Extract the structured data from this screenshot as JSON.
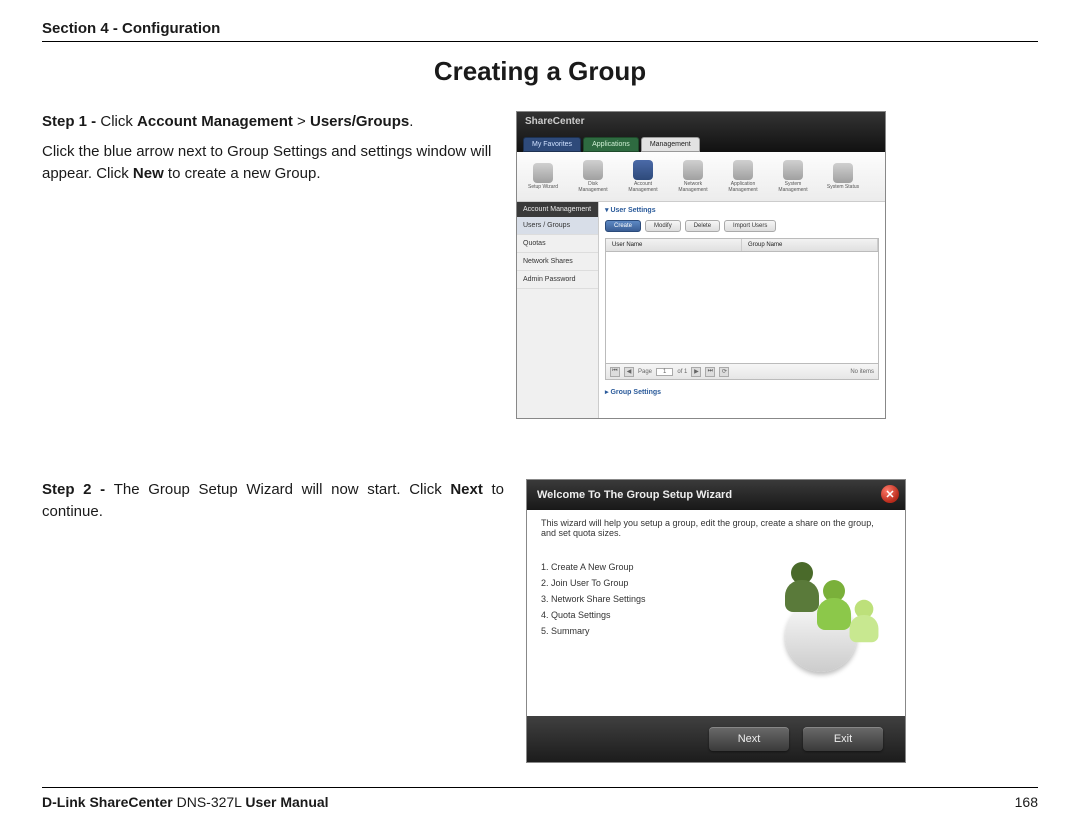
{
  "header": {
    "section": "Section 4 - Configuration"
  },
  "title": "Creating a Group",
  "step1": {
    "prefix": "Step 1 - ",
    "action": "Click ",
    "bold1": "Account Management",
    "gt": " > ",
    "bold2": "Users/Groups",
    "tail": ".",
    "body1": "Click the blue arrow next to Group Settings and settings window will appear. Click ",
    "bold_new": "New",
    "body2": " to create a new Group."
  },
  "shot1": {
    "logo": "ShareCenter",
    "tabs": [
      "My Favorites",
      "Applications",
      "Management"
    ],
    "icons": [
      "Setup Wizard",
      "Disk Management",
      "Account Management",
      "Network Management",
      "Application Management",
      "System Management",
      "System Status"
    ],
    "sidetitle": "Account Management",
    "sideitems": [
      "Users / Groups",
      "Quotas",
      "Network Shares",
      "Admin Password"
    ],
    "panel1": "▾ User Settings",
    "btns": [
      "Create",
      "Modify",
      "Delete",
      "Import Users"
    ],
    "cols": [
      "User Name",
      "Group Name"
    ],
    "pager": {
      "page": "Page",
      "of": "of 1",
      "noitems": "No items"
    },
    "panel2": "▸ Group Settings"
  },
  "step2": {
    "prefix": "Step 2 - ",
    "body1": "The Group Setup Wizard will now start. Click ",
    "bold_next": "Next",
    "body2": " to continue."
  },
  "shot2": {
    "title": "Welcome To The Group Setup Wizard",
    "desc": "This wizard will help you setup a group, edit the group, create a share on the group, and set quota sizes.",
    "items": [
      "1. Create A New Group",
      "2. Join User To Group",
      "3. Network Share Settings",
      "4. Quota Settings",
      "5. Summary"
    ],
    "next": "Next",
    "exit": "Exit"
  },
  "footer": {
    "brand": "D-Link ShareCenter",
    "model": " DNS-327L ",
    "tail": "User Manual",
    "page": "168"
  }
}
